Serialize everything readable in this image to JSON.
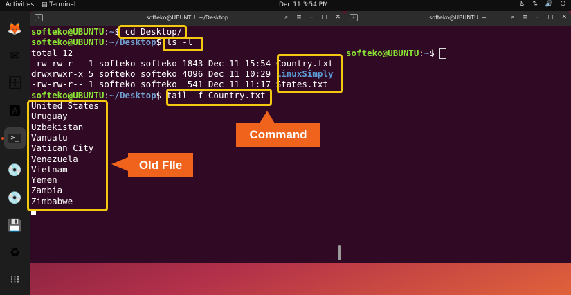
{
  "topbar": {
    "activities": "Activities",
    "app_name": "Terminal",
    "clock": "Dec 11   3:54 PM"
  },
  "dock": {
    "items": [
      "firefox-icon",
      "thunderbird-icon",
      "files-icon",
      "app-center-icon",
      "terminal-icon",
      "disc-icon",
      "disc-icon",
      "save-icon",
      "trash-icon",
      "app-grid-icon"
    ]
  },
  "window_left": {
    "title": "softeko@UBUNTU: ~/Desktop",
    "lines": [
      {
        "user": "softeko@UBUNTU",
        "path": "~",
        "cmd": " cd Desktop/"
      },
      {
        "user": "softeko@UBUNTU",
        "path": "~/Desktop",
        "cmd": " ls -l"
      },
      {
        "text": "total 12"
      },
      {
        "text": "-rw-rw-r-- 1 softeko softeko 1843 Dec 11 15:54 ",
        "name": "Country.txt"
      },
      {
        "text": "drwxrwxr-x 5 softeko softeko 4096 Dec 11 10:29 ",
        "dirname": "LinuxSimply"
      },
      {
        "text": "-rw-rw-r-- 1 softeko softeko  541 Dec 11 11:17 ",
        "name": "States.txt"
      },
      {
        "user": "softeko@UBUNTU",
        "path": "~/Desktop",
        "cmd": " tail -f Country.txt"
      },
      {
        "text": "United States"
      },
      {
        "text": "Uruguay"
      },
      {
        "text": "Uzbekistan"
      },
      {
        "text": "Vanuatu"
      },
      {
        "text": "Vatican City"
      },
      {
        "text": "Venezuela"
      },
      {
        "text": "Vietnam"
      },
      {
        "text": "Yemen"
      },
      {
        "text": "Zambia"
      },
      {
        "text": "Zimbabwe"
      }
    ]
  },
  "window_right": {
    "title": "softeko@UBUNTU: ~",
    "prompt_user": "softeko@UBUNTU",
    "prompt_path": "~"
  },
  "callouts": {
    "command": "Command",
    "old_file": "Old FIle"
  },
  "colors": {
    "terminal_bg": "#300a24",
    "prompt_user": "#8ae234",
    "prompt_path": "#729fcf",
    "highlight": "#f2c811",
    "callout": "#f0631c"
  }
}
